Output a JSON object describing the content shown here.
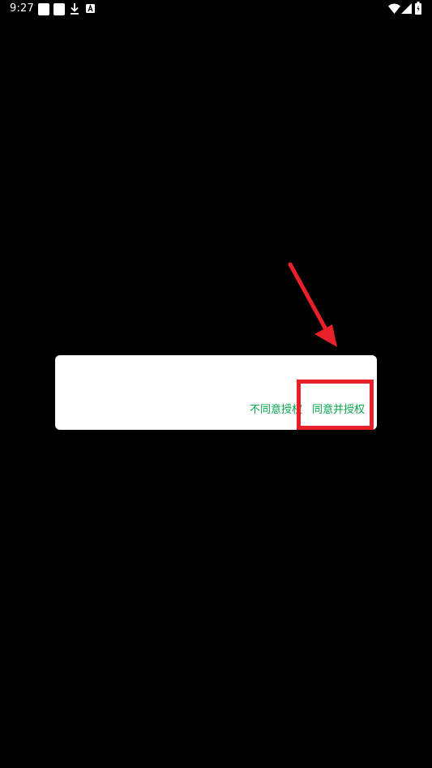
{
  "status_bar": {
    "time": "9:27",
    "notification_icons": [
      "app-notification-icon",
      "app-notification-icon",
      "download-icon",
      "a-badge-icon"
    ],
    "system_icons": [
      "wifi-icon",
      "cellular-signal-icon",
      "battery-icon"
    ]
  },
  "dialog": {
    "decline_label": "不同意授权",
    "accept_label": "同意并授权",
    "button_color": "#07a54a"
  },
  "annotation": {
    "highlight_color": "#e8202a"
  }
}
